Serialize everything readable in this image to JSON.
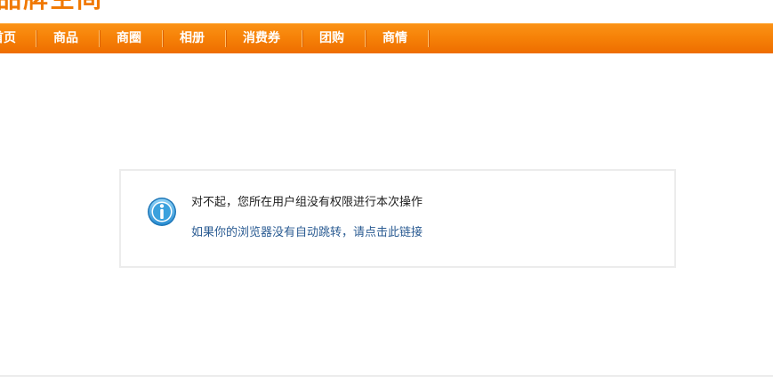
{
  "header": {
    "logo_text": "品牌空间"
  },
  "nav": {
    "items": [
      {
        "label": "首页"
      },
      {
        "label": "商品"
      },
      {
        "label": "商圈"
      },
      {
        "label": "相册"
      },
      {
        "label": "消费券"
      },
      {
        "label": "团购"
      },
      {
        "label": "商情"
      }
    ]
  },
  "message": {
    "icon": "info-icon",
    "text": "对不起，您所在用户组没有权限进行本次操作",
    "link_text": "如果你的浏览器没有自动跳转，请点击此链接"
  },
  "colors": {
    "nav_bar": "#f68208",
    "link": "#2a5b92",
    "box_border": "#ececec"
  }
}
